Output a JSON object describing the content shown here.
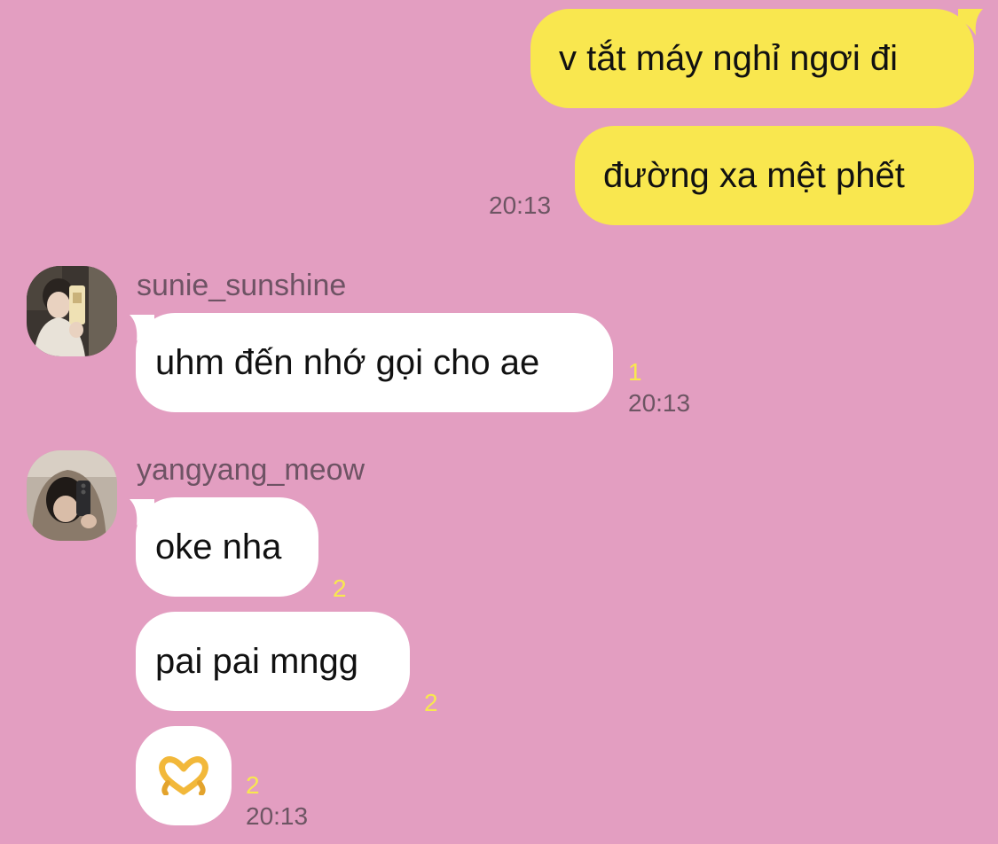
{
  "messages": {
    "sent": [
      {
        "text": "v tắt máy nghỉ ngơi đi"
      },
      {
        "text": "đường xa mệt phết"
      }
    ],
    "sent_time": "20:13",
    "group1": {
      "sender": "sunie_sunshine",
      "message": "uhm đến nhớ gọi cho ae",
      "unread": "1",
      "time": "20:13"
    },
    "group2": {
      "sender": "yangyang_meow",
      "messages": [
        {
          "text": "oke nha",
          "unread": "2"
        },
        {
          "text": "pai pai mngg",
          "unread": "2"
        },
        {
          "text": "🫶",
          "unread": "2"
        }
      ],
      "time": "20:13"
    }
  },
  "colors": {
    "background": "#e39ec1",
    "sent_bubble": "#f9e74f",
    "received_bubble": "#ffffff",
    "unread_count": "#f8e84f",
    "timestamp": "#6d5563"
  },
  "icons": {
    "heart_hands": "heart-hands-emoji"
  }
}
